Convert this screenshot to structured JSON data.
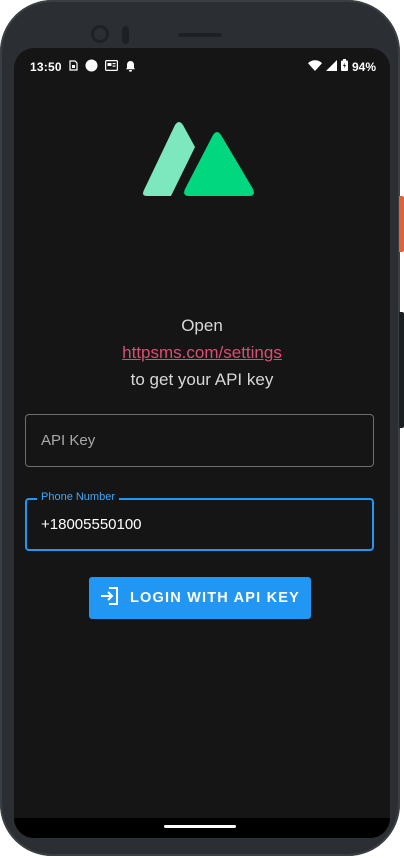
{
  "status_bar": {
    "time": "13:50",
    "battery": "94%",
    "left_icons": [
      "sim-icon",
      "circle-icon",
      "news-icon",
      "bell-icon"
    ],
    "right_icons": [
      "wifi-icon",
      "signal-icon",
      "battery-icon"
    ]
  },
  "brand": {
    "logo": "httpsms-logo",
    "colors": {
      "light": "#7de8bd",
      "dark": "#00d77f"
    }
  },
  "prompt": {
    "line1": "Open",
    "link": "httpsms.com/settings",
    "line3": "to get your API key"
  },
  "api_key_field": {
    "placeholder": "API Key",
    "value": ""
  },
  "phone_field": {
    "label": "Phone Number",
    "value": "+18005550100"
  },
  "login_button": {
    "label": "LOGIN WITH API KEY",
    "icon": "login-icon",
    "color": "#2196f3"
  },
  "theme": {
    "accent": "#2196f3",
    "link_color": "#e04b75",
    "background": "#151515"
  }
}
